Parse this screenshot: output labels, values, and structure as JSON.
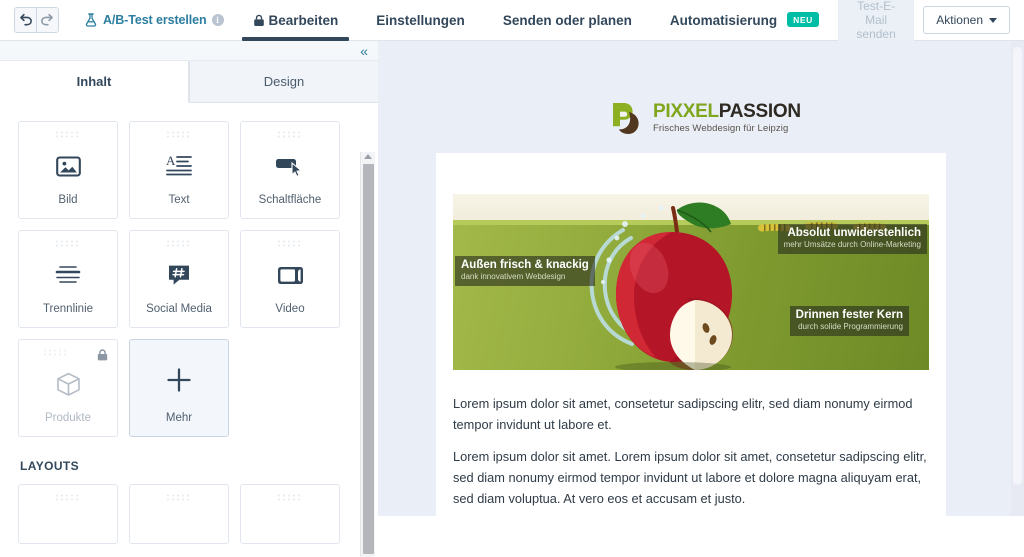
{
  "topbar": {
    "undo_icon": "undo-arrow-icon",
    "redo_icon": "redo-arrow-icon",
    "ab_test_label": "A/B-Test erstellen",
    "ab_test_icon": "flask-icon",
    "ab_test_info": "i",
    "tabs": [
      {
        "label": "Bearbeiten",
        "icon": "lock-icon",
        "active": true,
        "badge": ""
      },
      {
        "label": "Einstellungen",
        "icon": "",
        "active": false,
        "badge": ""
      },
      {
        "label": "Senden oder planen",
        "icon": "",
        "active": false,
        "badge": ""
      },
      {
        "label": "Automatisierung",
        "icon": "",
        "active": false,
        "badge": "NEU"
      }
    ],
    "test_email_label": "Test-E-Mail senden",
    "actions_label": "Aktionen",
    "actions_caret": "caret-down-icon",
    "accent_link": "#2c7ea1",
    "accent_dark": "#33475b",
    "badge_color": "#00bda5"
  },
  "left_panel": {
    "collapse_icon": "chevron-double-left-icon",
    "tabs": [
      {
        "label": "Inhalt",
        "active": true
      },
      {
        "label": "Design",
        "active": false
      }
    ],
    "blocks": [
      {
        "label": "Bild",
        "icon": "image-icon",
        "disabled": false,
        "selected": false,
        "locked": false
      },
      {
        "label": "Text",
        "icon": "text-icon",
        "disabled": false,
        "selected": false,
        "locked": false
      },
      {
        "label": "Schaltfläche",
        "icon": "button-cursor-icon",
        "disabled": false,
        "selected": false,
        "locked": false
      },
      {
        "label": "Trennlinie",
        "icon": "divider-icon",
        "disabled": false,
        "selected": false,
        "locked": false
      },
      {
        "label": "Social Media",
        "icon": "hashtag-bubble-icon",
        "disabled": false,
        "selected": false,
        "locked": false
      },
      {
        "label": "Video",
        "icon": "video-icon",
        "disabled": false,
        "selected": false,
        "locked": false
      },
      {
        "label": "Produkte",
        "icon": "box-icon",
        "disabled": true,
        "selected": false,
        "locked": true
      },
      {
        "label": "Mehr",
        "icon": "plus-icon",
        "disabled": false,
        "selected": true,
        "locked": false
      }
    ],
    "layouts_title": "LAYOUTS",
    "layout_count": 3
  },
  "email": {
    "logo": {
      "name_part1": "PIXXEL",
      "name_part2": "PASSION",
      "tagline": "Frisches Webdesign für Leipzig",
      "color1": "#7fa61c",
      "color2": "#2e2a23",
      "mark_icon": "leaf-logo-icon"
    },
    "banner": {
      "captions": [
        {
          "title": "Außen frisch & knackig",
          "sub": "dank innovativem Webdesign"
        },
        {
          "title": "Absolut unwiderstehlich",
          "sub": "mehr Umsätze durch Online-Marketing"
        },
        {
          "title": "Drinnen fester Kern",
          "sub": "durch solide Programmierung"
        }
      ],
      "image_alt": "apple-splash-banner-image"
    },
    "paragraphs": [
      "Lorem ipsum dolor sit amet, consetetur sadipscing elitr, sed diam nonumy eirmod tempor invidunt ut labore et.",
      "Lorem ipsum dolor sit amet. Lorem ipsum dolor sit amet, consetetur sadipscing elitr, sed diam nonumy eirmod tempor invidunt ut labore et dolore magna aliquyam erat, sed diam voluptua. At vero eos et accusam et justo."
    ]
  }
}
